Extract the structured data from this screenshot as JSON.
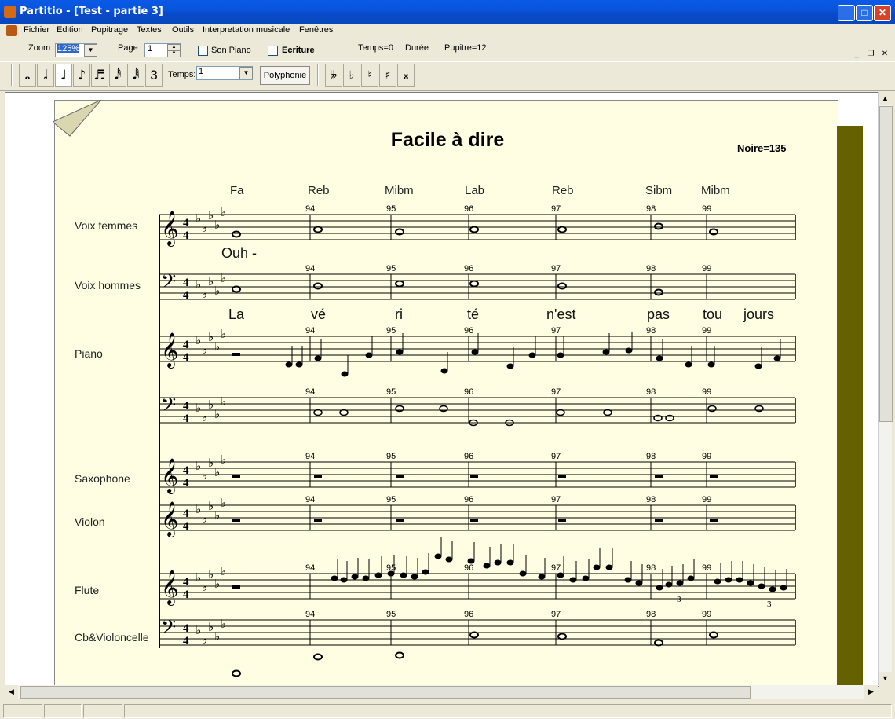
{
  "window": {
    "title": "Partitio - [Test - partie 3]"
  },
  "menu": [
    "Fichier",
    "Edition",
    "Pupitrage",
    "Textes",
    "Outils",
    "Interpretation musicale",
    "Fenêtres"
  ],
  "toolbar": {
    "zoom_label": "Zoom",
    "zoom_value": "125%",
    "page_label": "Page",
    "page_value": "1",
    "son_piano": "Son Piano",
    "ecriture": "Ecriture",
    "temps": "Temps=0",
    "duree": "Durée",
    "pupitre": "Pupitre=12",
    "temps_label": "Temps:",
    "temps_value": "1",
    "polyphonie": "Polyphonie",
    "triplet": "3"
  },
  "score": {
    "title": "Facile à dire",
    "tempo": "Noire=135",
    "chords": [
      "Fa",
      "Reb",
      "Mibm",
      "Lab",
      "Reb",
      "Sibm",
      "Mibm"
    ],
    "lyrics_women": [
      "Ouh -"
    ],
    "lyrics_men": [
      "La",
      "vé",
      "ri",
      "té",
      "n'est",
      "pas",
      "tou",
      "jours"
    ],
    "measure_numbers": [
      "94",
      "95",
      "96",
      "97",
      "98",
      "99"
    ],
    "instruments": [
      "Voix femmes",
      "Voix hommes",
      "Piano",
      "Saxophone",
      "Violon",
      "Flute",
      "Cb&Violoncelle"
    ],
    "time_signature": "4/4",
    "key_signature": "5 flats",
    "triplet_mark": "3"
  },
  "colors": {
    "paper": "#fffee3",
    "side_bar": "#666100",
    "titlebar": "#0a5ae6"
  },
  "icons": [
    "app-icon",
    "minimize-icon",
    "maximize-icon",
    "close-icon",
    "whole-note-icon",
    "half-note-icon",
    "quarter-note-icon",
    "eighth-note-icon",
    "sixteenth-note-icon",
    "32nd-note-icon",
    "64th-note-icon",
    "double-flat-icon",
    "flat-icon",
    "natural-icon",
    "sharp-icon",
    "double-sharp-icon"
  ]
}
